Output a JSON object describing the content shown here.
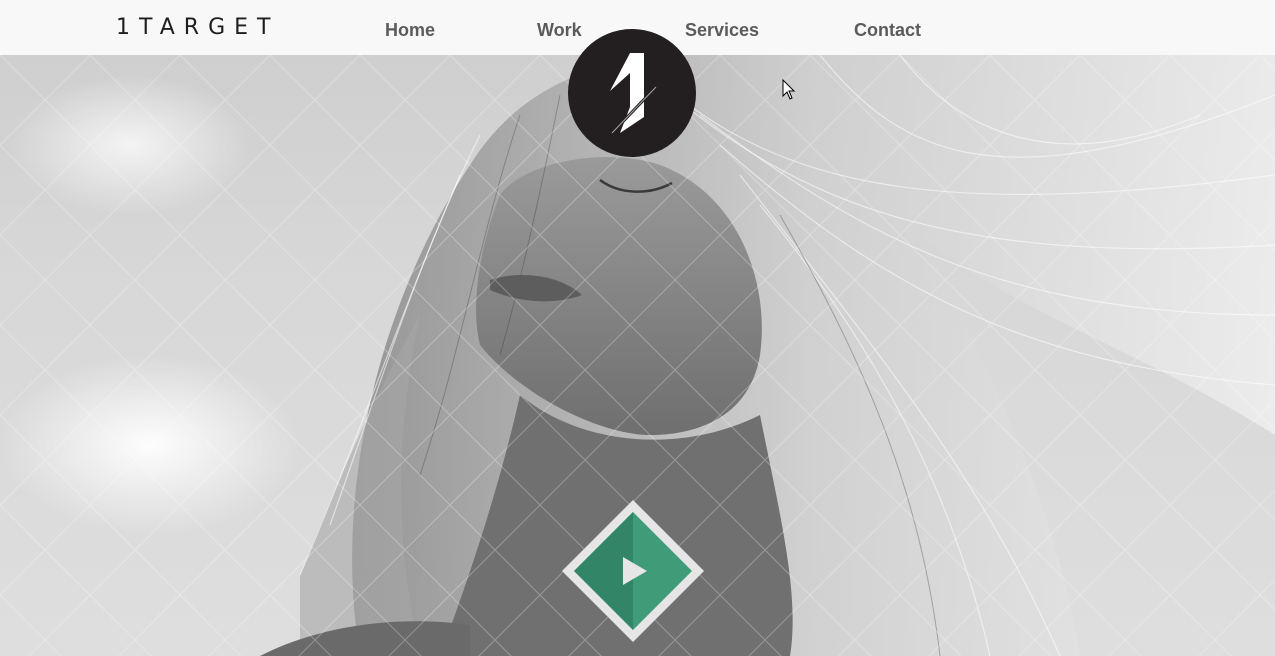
{
  "header": {
    "logo_text": "1TARGET",
    "nav": [
      {
        "label": "Home"
      },
      {
        "label": "Work"
      },
      {
        "label": "Services"
      },
      {
        "label": "Contact"
      }
    ]
  },
  "badge": {
    "icon": "number-one-logo-icon"
  },
  "hero": {
    "image": "woman-hair-in-wind-photo",
    "play_button_icon": "play-icon"
  },
  "colors": {
    "topbar_bg": "#f8f8f8",
    "nav_text": "#5b5b5b",
    "logo_text": "#1e1e1e",
    "badge_bg": "#231f20",
    "play_green": "#3f9b78",
    "play_green_dark": "#2f7f61"
  }
}
